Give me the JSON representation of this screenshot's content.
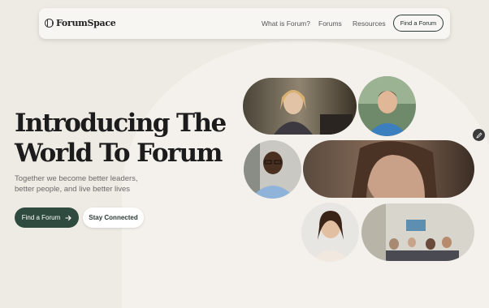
{
  "brand": {
    "name": "ForumSpace"
  },
  "nav": {
    "links": [
      "What is Forum?",
      "Forums",
      "Resources"
    ],
    "cta_label": "Find a Forum"
  },
  "hero": {
    "title_line1": "Introducing The",
    "title_line2": "World To Forum",
    "subtitle": "Together we become better leaders, better people, and live better lives",
    "primary_label": "Find a Forum",
    "secondary_label": "Stay Connected"
  },
  "icons": {
    "logo": "logo-icon",
    "arrow": "arrow-right-icon",
    "edit": "pencil-icon"
  },
  "colors": {
    "background": "#eeeae4",
    "accent": "#2f4b40"
  }
}
